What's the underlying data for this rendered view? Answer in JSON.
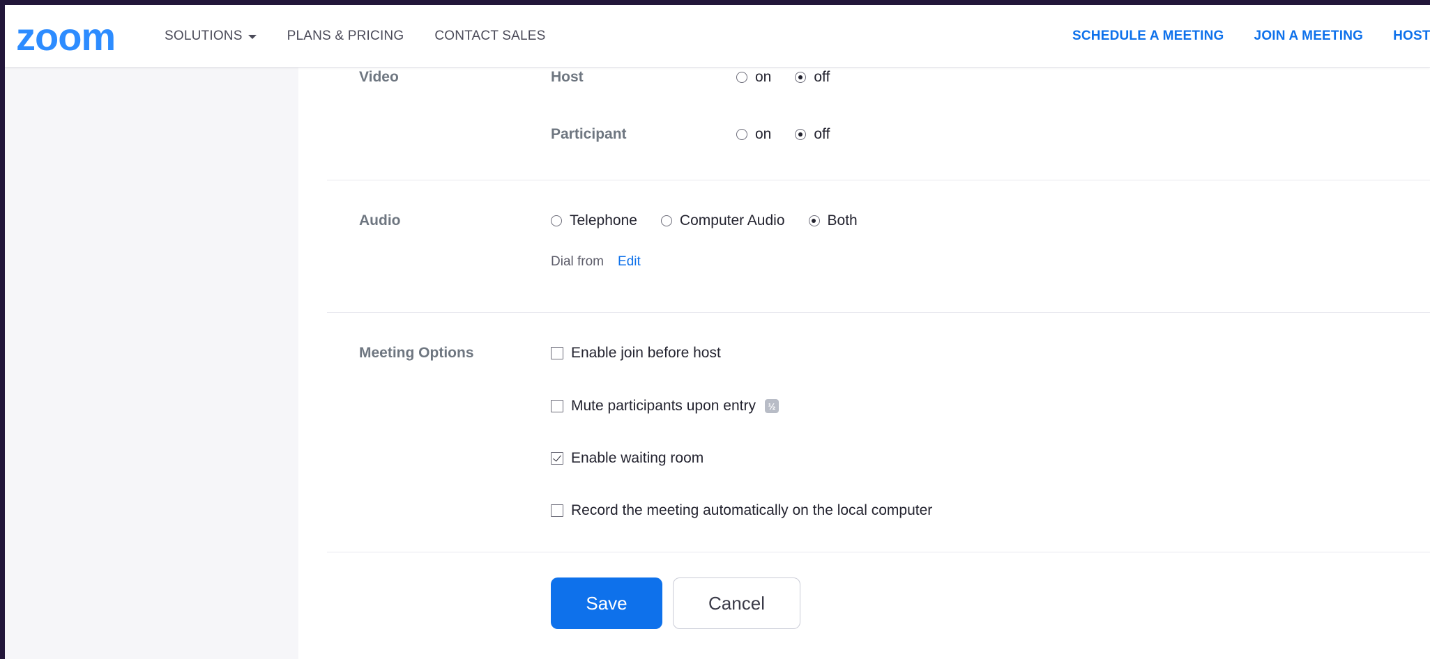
{
  "header": {
    "logo_text": "zoom",
    "nav_left": [
      {
        "label": "SOLUTIONS",
        "has_dropdown": true
      },
      {
        "label": "PLANS & PRICING",
        "has_dropdown": false
      },
      {
        "label": "CONTACT SALES",
        "has_dropdown": false
      }
    ],
    "nav_right": [
      {
        "label": "SCHEDULE A MEETING"
      },
      {
        "label": "JOIN A MEETING"
      },
      {
        "label": "HOST A MEETING"
      }
    ]
  },
  "video": {
    "label": "Video",
    "host": {
      "label": "Host",
      "on_label": "on",
      "off_label": "off",
      "selected": "off"
    },
    "participant": {
      "label": "Participant",
      "on_label": "on",
      "off_label": "off",
      "selected": "off"
    }
  },
  "audio": {
    "label": "Audio",
    "options": [
      {
        "label": "Telephone",
        "checked": false
      },
      {
        "label": "Computer Audio",
        "checked": false
      },
      {
        "label": "Both",
        "checked": true
      }
    ],
    "dial_from_label": "Dial from",
    "edit_label": "Edit"
  },
  "meeting_options": {
    "label": "Meeting Options",
    "items": [
      {
        "label": "Enable join before host",
        "checked": false
      },
      {
        "label": "Mute participants upon entry",
        "checked": false,
        "info_icon": "info-icon"
      },
      {
        "label": "Enable waiting room",
        "checked": true
      },
      {
        "label": "Record the meeting automatically on the local computer",
        "checked": false
      }
    ]
  },
  "actions": {
    "save_label": "Save",
    "cancel_label": "Cancel"
  },
  "colors": {
    "brand": "#2d8cff",
    "link": "#0e71eb",
    "frame": "#22163a"
  }
}
